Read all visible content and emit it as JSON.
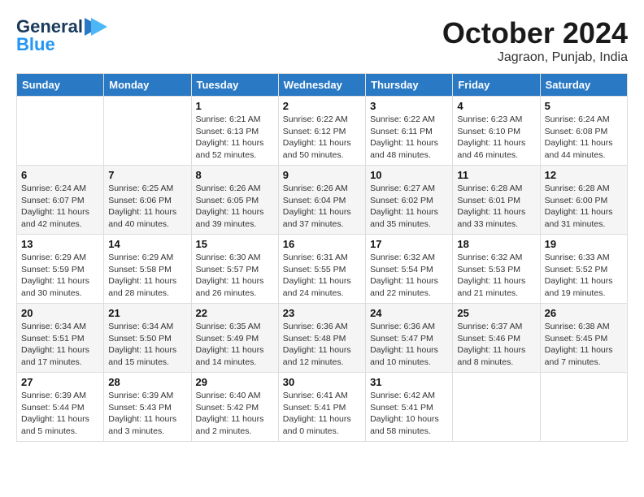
{
  "header": {
    "logo_general": "General",
    "logo_blue": "Blue",
    "month_title": "October 2024",
    "location": "Jagraon, Punjab, India"
  },
  "days_of_week": [
    "Sunday",
    "Monday",
    "Tuesday",
    "Wednesday",
    "Thursday",
    "Friday",
    "Saturday"
  ],
  "weeks": [
    [
      {
        "day": "",
        "info": ""
      },
      {
        "day": "",
        "info": ""
      },
      {
        "day": "1",
        "info": "Sunrise: 6:21 AM\nSunset: 6:13 PM\nDaylight: 11 hours and 52 minutes."
      },
      {
        "day": "2",
        "info": "Sunrise: 6:22 AM\nSunset: 6:12 PM\nDaylight: 11 hours and 50 minutes."
      },
      {
        "day": "3",
        "info": "Sunrise: 6:22 AM\nSunset: 6:11 PM\nDaylight: 11 hours and 48 minutes."
      },
      {
        "day": "4",
        "info": "Sunrise: 6:23 AM\nSunset: 6:10 PM\nDaylight: 11 hours and 46 minutes."
      },
      {
        "day": "5",
        "info": "Sunrise: 6:24 AM\nSunset: 6:08 PM\nDaylight: 11 hours and 44 minutes."
      }
    ],
    [
      {
        "day": "6",
        "info": "Sunrise: 6:24 AM\nSunset: 6:07 PM\nDaylight: 11 hours and 42 minutes."
      },
      {
        "day": "7",
        "info": "Sunrise: 6:25 AM\nSunset: 6:06 PM\nDaylight: 11 hours and 40 minutes."
      },
      {
        "day": "8",
        "info": "Sunrise: 6:26 AM\nSunset: 6:05 PM\nDaylight: 11 hours and 39 minutes."
      },
      {
        "day": "9",
        "info": "Sunrise: 6:26 AM\nSunset: 6:04 PM\nDaylight: 11 hours and 37 minutes."
      },
      {
        "day": "10",
        "info": "Sunrise: 6:27 AM\nSunset: 6:02 PM\nDaylight: 11 hours and 35 minutes."
      },
      {
        "day": "11",
        "info": "Sunrise: 6:28 AM\nSunset: 6:01 PM\nDaylight: 11 hours and 33 minutes."
      },
      {
        "day": "12",
        "info": "Sunrise: 6:28 AM\nSunset: 6:00 PM\nDaylight: 11 hours and 31 minutes."
      }
    ],
    [
      {
        "day": "13",
        "info": "Sunrise: 6:29 AM\nSunset: 5:59 PM\nDaylight: 11 hours and 30 minutes."
      },
      {
        "day": "14",
        "info": "Sunrise: 6:29 AM\nSunset: 5:58 PM\nDaylight: 11 hours and 28 minutes."
      },
      {
        "day": "15",
        "info": "Sunrise: 6:30 AM\nSunset: 5:57 PM\nDaylight: 11 hours and 26 minutes."
      },
      {
        "day": "16",
        "info": "Sunrise: 6:31 AM\nSunset: 5:55 PM\nDaylight: 11 hours and 24 minutes."
      },
      {
        "day": "17",
        "info": "Sunrise: 6:32 AM\nSunset: 5:54 PM\nDaylight: 11 hours and 22 minutes."
      },
      {
        "day": "18",
        "info": "Sunrise: 6:32 AM\nSunset: 5:53 PM\nDaylight: 11 hours and 21 minutes."
      },
      {
        "day": "19",
        "info": "Sunrise: 6:33 AM\nSunset: 5:52 PM\nDaylight: 11 hours and 19 minutes."
      }
    ],
    [
      {
        "day": "20",
        "info": "Sunrise: 6:34 AM\nSunset: 5:51 PM\nDaylight: 11 hours and 17 minutes."
      },
      {
        "day": "21",
        "info": "Sunrise: 6:34 AM\nSunset: 5:50 PM\nDaylight: 11 hours and 15 minutes."
      },
      {
        "day": "22",
        "info": "Sunrise: 6:35 AM\nSunset: 5:49 PM\nDaylight: 11 hours and 14 minutes."
      },
      {
        "day": "23",
        "info": "Sunrise: 6:36 AM\nSunset: 5:48 PM\nDaylight: 11 hours and 12 minutes."
      },
      {
        "day": "24",
        "info": "Sunrise: 6:36 AM\nSunset: 5:47 PM\nDaylight: 11 hours and 10 minutes."
      },
      {
        "day": "25",
        "info": "Sunrise: 6:37 AM\nSunset: 5:46 PM\nDaylight: 11 hours and 8 minutes."
      },
      {
        "day": "26",
        "info": "Sunrise: 6:38 AM\nSunset: 5:45 PM\nDaylight: 11 hours and 7 minutes."
      }
    ],
    [
      {
        "day": "27",
        "info": "Sunrise: 6:39 AM\nSunset: 5:44 PM\nDaylight: 11 hours and 5 minutes."
      },
      {
        "day": "28",
        "info": "Sunrise: 6:39 AM\nSunset: 5:43 PM\nDaylight: 11 hours and 3 minutes."
      },
      {
        "day": "29",
        "info": "Sunrise: 6:40 AM\nSunset: 5:42 PM\nDaylight: 11 hours and 2 minutes."
      },
      {
        "day": "30",
        "info": "Sunrise: 6:41 AM\nSunset: 5:41 PM\nDaylight: 11 hours and 0 minutes."
      },
      {
        "day": "31",
        "info": "Sunrise: 6:42 AM\nSunset: 5:41 PM\nDaylight: 10 hours and 58 minutes."
      },
      {
        "day": "",
        "info": ""
      },
      {
        "day": "",
        "info": ""
      }
    ]
  ]
}
